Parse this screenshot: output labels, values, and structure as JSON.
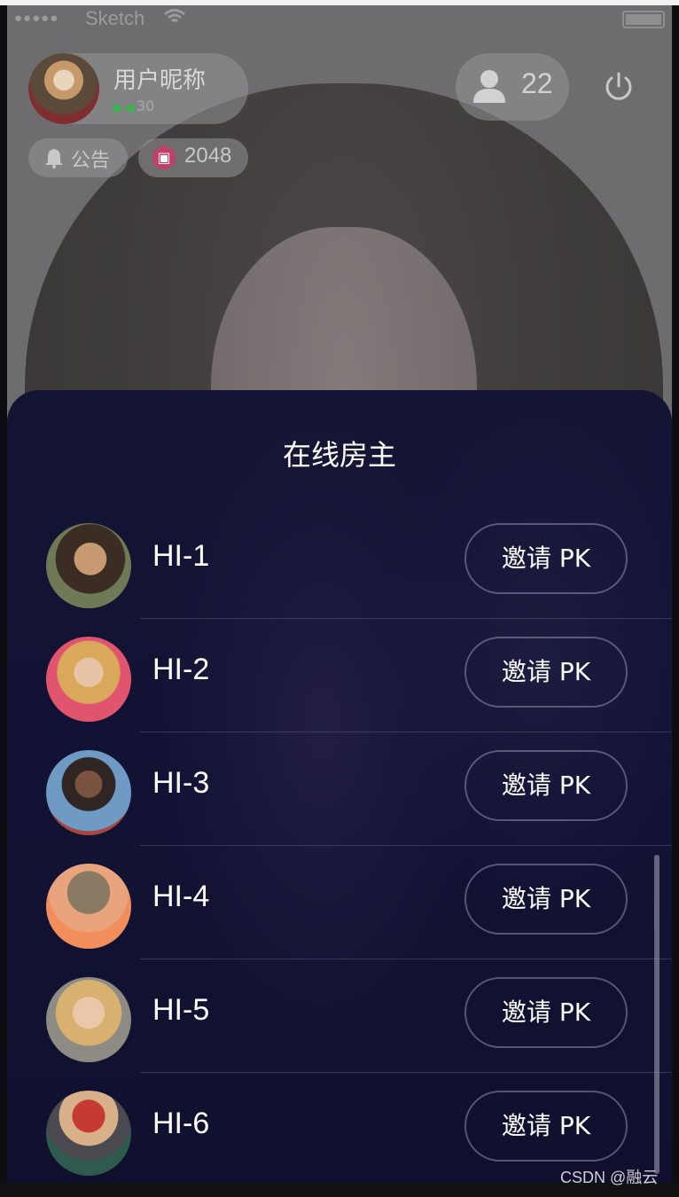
{
  "status_bar": {
    "carrier": "Sketch"
  },
  "host_info": {
    "name": "用户昵称",
    "level": "30"
  },
  "viewer": {
    "count": "22"
  },
  "notice": {
    "label": "公告"
  },
  "gift": {
    "count": "2048"
  },
  "sheet": {
    "title": "在线房主",
    "hosts": [
      {
        "name": "HI-1",
        "invite_label": "邀请 PK"
      },
      {
        "name": "HI-2",
        "invite_label": "邀请 PK"
      },
      {
        "name": "HI-3",
        "invite_label": "邀请 PK"
      },
      {
        "name": "HI-4",
        "invite_label": "邀请 PK"
      },
      {
        "name": "HI-5",
        "invite_label": "邀请 PK"
      },
      {
        "name": "HI-6",
        "invite_label": "邀请 PK"
      }
    ]
  },
  "watermark": "CSDN @融云",
  "icons": [
    "wifi-icon",
    "battery-icon",
    "person-icon",
    "power-icon",
    "bell-icon",
    "gift-icon",
    "signal-icon"
  ],
  "colors": {
    "sheet_bg": "#121234",
    "gift_accent": "#c23f6c",
    "signal_green": "#39b54a"
  }
}
